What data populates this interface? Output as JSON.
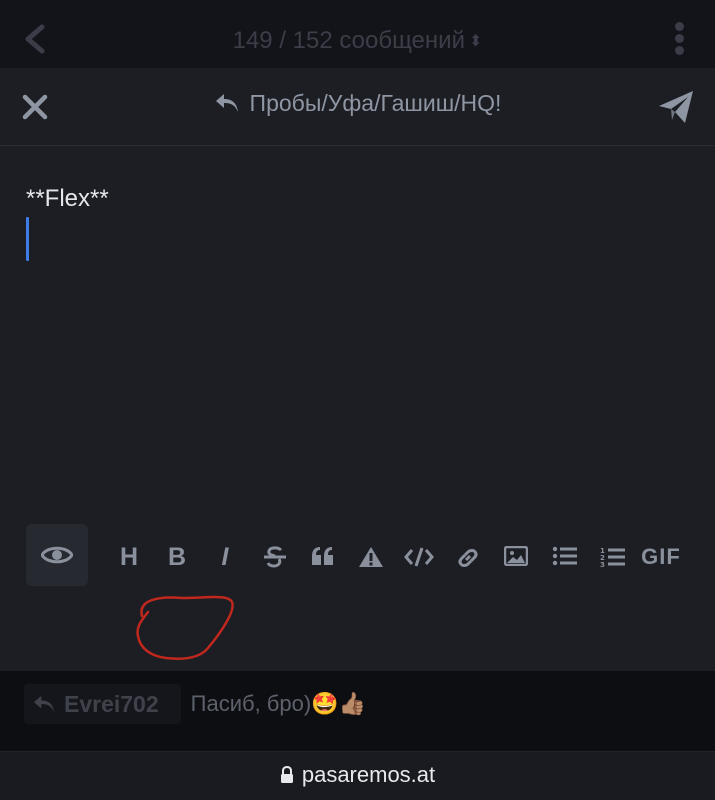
{
  "topbar": {
    "counter_text": "149 / 152 сообщений",
    "sort_icon": "sort-icon"
  },
  "composer": {
    "reply_to": "Пробы/Уфа/Гашиш/HQ!",
    "editor_text": "**Flex**",
    "icons": {
      "close": "close-icon",
      "send": "send-icon",
      "reply": "reply-icon"
    }
  },
  "toolbar": {
    "preview": "eye-icon",
    "heading": "H",
    "bold": "B",
    "italic": "I",
    "gif": "GIF",
    "annotation_color": "#c0281e"
  },
  "message": {
    "author": "Evrei702",
    "text": "Пасиб, бро)🤩👍🏽"
  },
  "urlbar": {
    "domain": "pasaremos.at"
  },
  "colors": {
    "accent_caret": "#3f7de8",
    "panel": "#1c1e24",
    "background": "#0d0e12"
  }
}
